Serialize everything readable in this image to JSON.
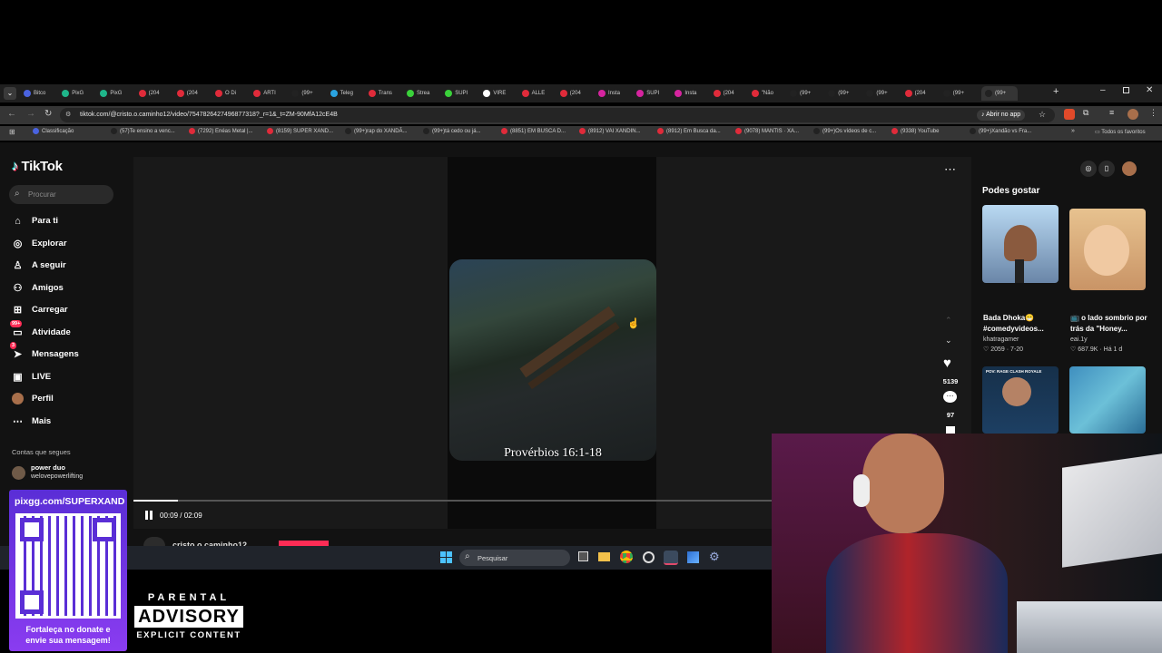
{
  "browser": {
    "tabs": [
      {
        "label": "Bitco",
        "color": "#4a63e0"
      },
      {
        "label": "PixG",
        "color": "#1fb58a"
      },
      {
        "label": "PixG",
        "color": "#1fb58a"
      },
      {
        "label": "(204",
        "color": "#e02b3a"
      },
      {
        "label": "(204",
        "color": "#e02b3a"
      },
      {
        "label": "O Di",
        "color": "#e02b3a"
      },
      {
        "label": "ARTI",
        "color": "#e02b3a"
      },
      {
        "label": "(99+",
        "color": "#222"
      },
      {
        "label": "Teleg",
        "color": "#2aa3e0"
      },
      {
        "label": "Trans",
        "color": "#e02b3a"
      },
      {
        "label": "Strea",
        "color": "#3ad13a"
      },
      {
        "label": "SUPI",
        "color": "#3ad13a"
      },
      {
        "label": "VIRE",
        "color": "#ffffff"
      },
      {
        "label": "ALLE",
        "color": "#e02b3a"
      },
      {
        "label": "(204",
        "color": "#e02b3a"
      },
      {
        "label": "Insta",
        "color": "#d6249f"
      },
      {
        "label": "SUPI",
        "color": "#d6249f"
      },
      {
        "label": "Insta",
        "color": "#d6249f"
      },
      {
        "label": "(204",
        "color": "#e02b3a"
      },
      {
        "label": "\"Não",
        "color": "#e02b3a"
      },
      {
        "label": "(99+",
        "color": "#222"
      },
      {
        "label": "(99+",
        "color": "#222"
      },
      {
        "label": "(99+",
        "color": "#222"
      },
      {
        "label": "(204",
        "color": "#e02b3a"
      },
      {
        "label": "(99+",
        "color": "#222"
      },
      {
        "label": "(99+",
        "color": "#222"
      }
    ],
    "url": "tiktok.com/@cristo.o.caminho12/video/7547826427496877318?_r=1&_t=ZM-90MfA12cE4B",
    "open_in_app": "Abrir no app",
    "bookmarks": [
      {
        "label": "Classificação",
        "color": "#4a63e0"
      },
      {
        "label": "(57)Te ensino a venc...",
        "color": "#222"
      },
      {
        "label": "(7292) Enéas Metal |...",
        "color": "#e02b3a"
      },
      {
        "label": "(8159) SUPER XAND...",
        "color": "#e02b3a"
      },
      {
        "label": "(99+)rap do XANDÃ...",
        "color": "#222"
      },
      {
        "label": "(99+)tá cedo ou já...",
        "color": "#222"
      },
      {
        "label": "(8851) EM BUSCA D...",
        "color": "#e02b3a"
      },
      {
        "label": "(8912) VAI XANDIN...",
        "color": "#e02b3a"
      },
      {
        "label": "(8912) Em Busca da...",
        "color": "#e02b3a"
      },
      {
        "label": "(9078) MANTIS · XA...",
        "color": "#e02b3a"
      },
      {
        "label": "(99+)Os vídeos de c...",
        "color": "#222"
      },
      {
        "label": "(9338) YouTube",
        "color": "#e02b3a"
      },
      {
        "label": "(99+)Xandão vs Fra...",
        "color": "#222"
      }
    ],
    "all_bookmarks": "Todos os favoritos"
  },
  "tiktok": {
    "logo": "TikTok",
    "search_placeholder": "Procurar",
    "nav": [
      {
        "label": "Para ti",
        "icon": "home-icon",
        "glyph": "⌂"
      },
      {
        "label": "Explorar",
        "icon": "compass-icon",
        "glyph": "◎"
      },
      {
        "label": "A seguir",
        "icon": "following-icon",
        "glyph": "♙"
      },
      {
        "label": "Amigos",
        "icon": "friends-icon",
        "glyph": "⚇"
      },
      {
        "label": "Carregar",
        "icon": "upload-icon",
        "glyph": "⊞"
      },
      {
        "label": "Atividade",
        "icon": "activity-icon",
        "glyph": "▭",
        "badge": "99+"
      },
      {
        "label": "Mensagens",
        "icon": "messages-icon",
        "glyph": "➤",
        "badge": "3"
      },
      {
        "label": "LIVE",
        "icon": "live-icon",
        "glyph": "▣"
      },
      {
        "label": "Perfil",
        "icon": "avatar",
        "glyph": ""
      },
      {
        "label": "Mais",
        "icon": "more-icon",
        "glyph": "⋯"
      }
    ],
    "following_title": "Contas que segues",
    "following": [
      {
        "name": "power duo",
        "handle": "welovepowerlifting"
      }
    ],
    "video": {
      "caption": "Provérbios 16:1-18",
      "time": "00:09 / 02:09",
      "progress": 0.07,
      "author": "cristo.o.caminho12"
    },
    "actions": {
      "likes": "5139",
      "comments": "97"
    },
    "recommend_title": "Podes gostar",
    "recommendations": [
      {
        "title": "Bada Dhoka😁 #comedyvideos...",
        "author": "khatragamer",
        "likes": "2059",
        "date": "7-20"
      },
      {
        "title": "📺 o lado sombrio por trás da \"Honey...",
        "author": "eai.1y",
        "likes": "687.9K",
        "date": "Há 1 d"
      },
      {
        "title": "",
        "author": "",
        "likes": "",
        "date": "",
        "overlay": "POV: RAGE CLASH ROYALE"
      },
      {
        "title": "",
        "author": "",
        "likes": "",
        "date": ""
      }
    ]
  },
  "taskbar": {
    "search": "Pesquisar"
  },
  "overlay": {
    "pix_url": "pixgg.com/SUPERXAND",
    "pix_message": "Fortaleça no donate e envie sua mensagem!",
    "advisory": {
      "line1": "PARENTAL",
      "line2": "ADVISORY",
      "line3": "EXPLICIT CONTENT"
    }
  },
  "colors": {
    "accent": "#fe2c55",
    "bg": "#121212",
    "chrome": "#353535"
  }
}
